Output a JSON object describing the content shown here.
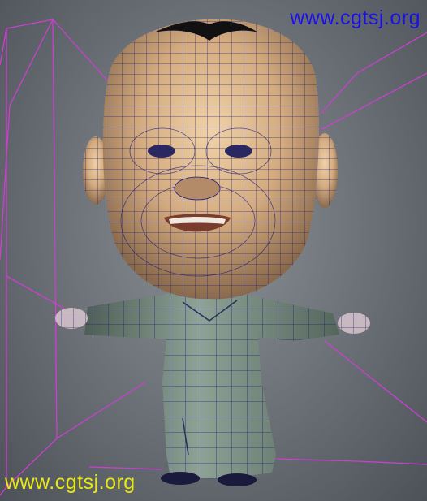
{
  "viewport": {
    "watermark_top": "www.cgtsj.org",
    "watermark_bottom": "www.cgtsj.org",
    "colors": {
      "watermark_top": "#1a10e6",
      "watermark_bottom": "#e8e812",
      "camera_frustum": "#cc3fd0",
      "skin": "#d9b48c",
      "robe": "#6f8378",
      "wireframe": "#1c1a7a",
      "hair": "#111111"
    }
  }
}
